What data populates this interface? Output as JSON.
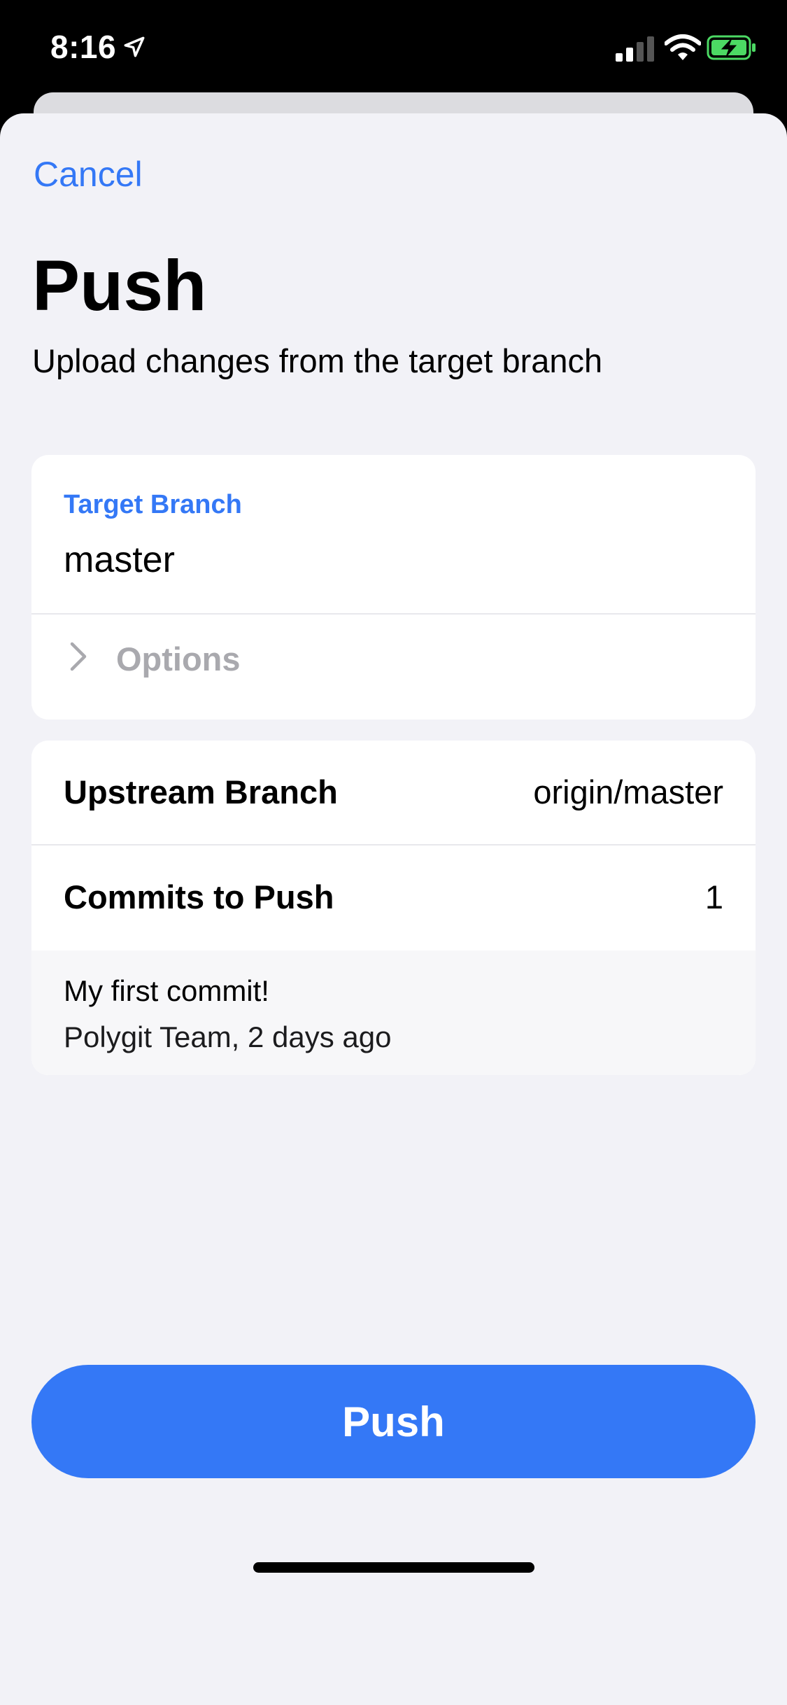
{
  "status_bar": {
    "time": "8:16"
  },
  "header": {
    "cancel_label": "Cancel",
    "title": "Push",
    "subtitle": "Upload changes from the target branch"
  },
  "target": {
    "label": "Target Branch",
    "value": "master",
    "options_label": "Options"
  },
  "details": {
    "upstream_label": "Upstream Branch",
    "upstream_value": "origin/master",
    "commits_label": "Commits to Push",
    "commits_value": "1"
  },
  "commit": {
    "message": "My first commit!",
    "meta": "Polygit Team, 2 days ago"
  },
  "footer": {
    "push_label": "Push"
  },
  "colors": {
    "accent": "#3478f6",
    "background": "#f2f2f7",
    "card": "#ffffff",
    "muted": "#a9a9ae",
    "battery_green": "#4cd964"
  },
  "icons": [
    "location-arrow-icon",
    "cellular-signal-icon",
    "wifi-icon",
    "battery-charging-icon",
    "chevron-right-icon"
  ]
}
